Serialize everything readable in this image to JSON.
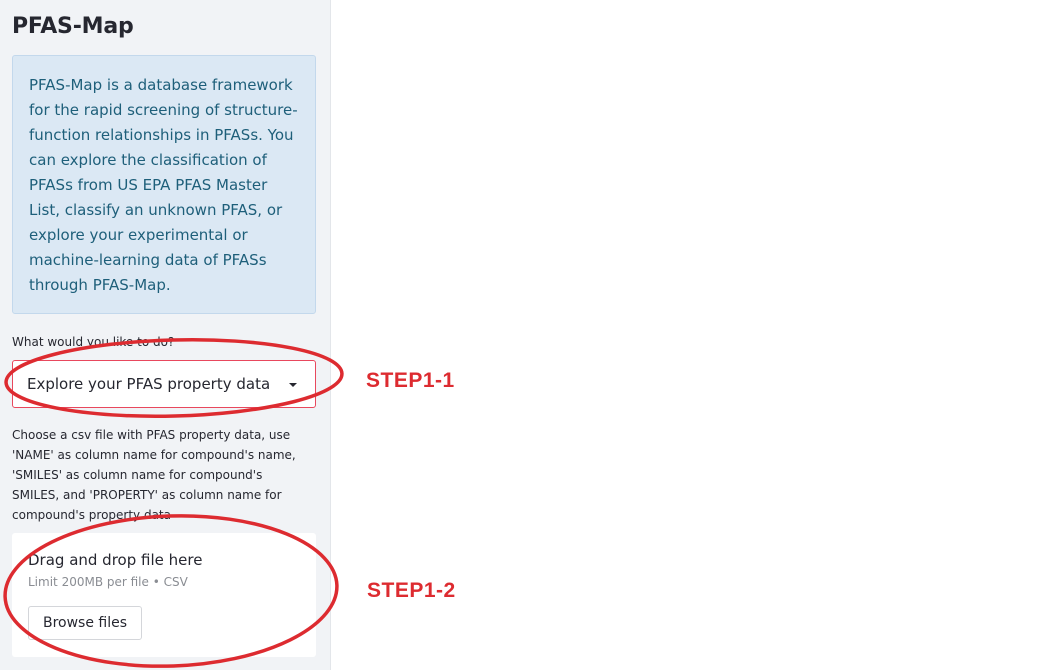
{
  "sidebar": {
    "title": "PFAS-Map",
    "info_text": "PFAS-Map is a database framework for the rapid screening of structure-function relationships in PFASs. You can explore the classification of PFASs from US EPA PFAS Master List, classify an unknown PFAS, or explore your experimental or machine-learning data of PFASs through PFAS-Map.",
    "select": {
      "label": "What would you like to do?",
      "value": "Explore your PFAS property data",
      "icon": "chevron-down-icon"
    },
    "uploader": {
      "label": "Choose a csv file with PFAS property data, use 'NAME' as column name for compound's name, 'SMILES' as column name for compound's SMILES, and 'PROPERTY' as column name for compound's property data",
      "drop_text": "Drag and drop file here",
      "limit_text": "Limit 200MB per file • CSV",
      "browse_label": "Browse files"
    }
  },
  "annotations": {
    "step1": "STEP1-1",
    "step2": "STEP1-2",
    "color": "#dd2b30"
  },
  "colors": {
    "sidebar_bg": "#f1f3f6",
    "info_bg": "#dbe8f4",
    "info_text": "#1e5f7a",
    "select_border": "#e8485d"
  }
}
